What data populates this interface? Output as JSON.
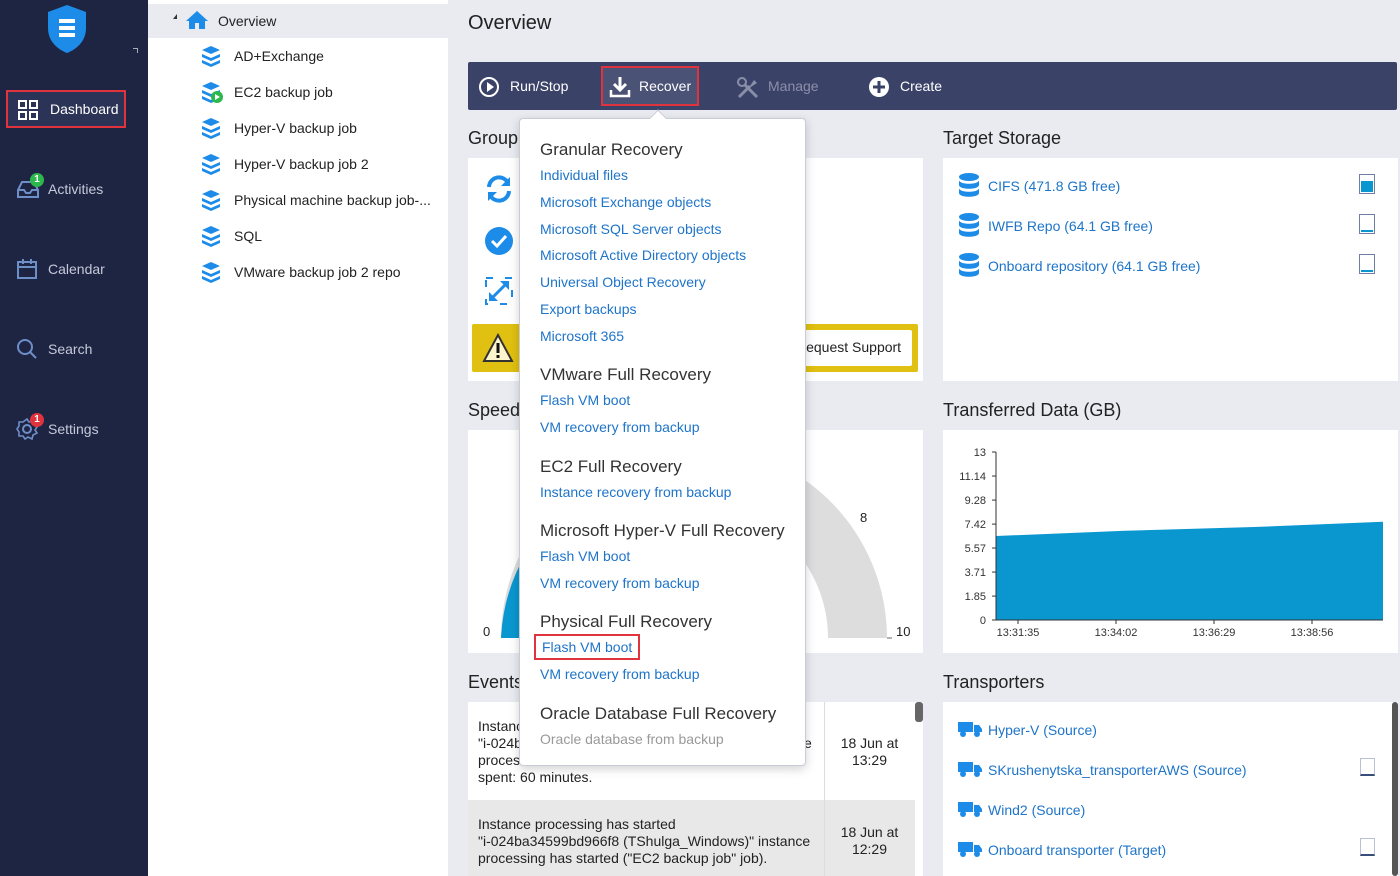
{
  "nav": {
    "items": [
      {
        "label": "Dashboard",
        "active": true
      },
      {
        "label": "Activities",
        "badge": "1"
      },
      {
        "label": "Calendar"
      },
      {
        "label": "Search"
      },
      {
        "label": "Settings",
        "badge": "1"
      }
    ]
  },
  "tree": {
    "root": "Overview",
    "items": [
      "AD+Exchange",
      "EC2 backup job",
      "Hyper-V backup job",
      "Hyper-V backup job 2",
      "Physical machine backup job-...",
      "SQL",
      "VMware backup job 2 repo"
    ]
  },
  "header": {
    "title": "Overview"
  },
  "toolbar": {
    "run_stop": "Run/Stop",
    "recover": "Recover",
    "manage": "Manage",
    "create": "Create"
  },
  "sections": {
    "group": "Group",
    "target_storage": "Target Storage",
    "speed": "Speed",
    "transferred": "Transferred Data (GB)",
    "events": "Events",
    "transporters": "Transporters"
  },
  "group_panel": {
    "request_support": "Request Support"
  },
  "storage": [
    {
      "label": "CIFS (471.8 GB free)",
      "used": 0.7
    },
    {
      "label": "IWFB Repo (64.1 GB free)",
      "used": 0.1
    },
    {
      "label": "Onboard repository (64.1 GB free)",
      "used": 0.1
    }
  ],
  "transporters": [
    {
      "label": "Hyper-V (Source)"
    },
    {
      "label": "SKrushenytska_transporterAWS (Source)"
    },
    {
      "label": "Wind2 (Source)"
    },
    {
      "label": "Onboard transporter (Target)"
    }
  ],
  "gauge": {
    "min": "0",
    "mid": "8",
    "max": "10"
  },
  "events": [
    {
      "line1": "Instanc",
      "line2": "\"i-024b",
      "line3": "process",
      "line4": "spent: 60 minutes.",
      "date1": "18 Jun at",
      "date2": "13:29",
      "tail": "e"
    },
    {
      "line1": "Instance processing has started",
      "line2": "\"i-024ba34599bd966f8 (TShulga_Windows)\" instance",
      "line3": "processing has started (\"EC2 backup job\" job).",
      "date1": "18 Jun at",
      "date2": "12:29"
    }
  ],
  "recover_menu": {
    "granular": {
      "title": "Granular Recovery",
      "items": [
        "Individual files",
        "Microsoft Exchange objects",
        "Microsoft SQL Server objects",
        "Microsoft Active Directory objects",
        "Universal Object Recovery",
        "Export backups",
        "Microsoft 365"
      ]
    },
    "vmware": {
      "title": "VMware Full Recovery",
      "items": [
        "Flash VM boot",
        "VM recovery from backup"
      ]
    },
    "ec2": {
      "title": "EC2 Full Recovery",
      "items": [
        "Instance recovery from backup"
      ]
    },
    "hyperv": {
      "title": "Microsoft Hyper-V Full Recovery",
      "items": [
        "Flash VM boot",
        "VM recovery from backup"
      ]
    },
    "physical": {
      "title": "Physical Full Recovery",
      "items": [
        "Flash VM boot",
        "VM recovery from backup"
      ]
    },
    "oracle": {
      "title": "Oracle Database Full Recovery",
      "items": [
        "Oracle database from backup"
      ]
    }
  },
  "chart_data": {
    "type": "area",
    "title": "Transferred Data (GB)",
    "x": [
      "13:31:35",
      "13:34:02",
      "13:36:29",
      "13:38:56"
    ],
    "y_ticks": [
      "13",
      "11.14",
      "9.28",
      "7.42",
      "5.57",
      "3.71",
      "1.85",
      "0"
    ],
    "ylim": [
      0,
      13
    ],
    "series": [
      {
        "values": [
          6.5,
          6.9,
          7.2,
          7.6
        ]
      }
    ],
    "color": "#0a97d0"
  }
}
